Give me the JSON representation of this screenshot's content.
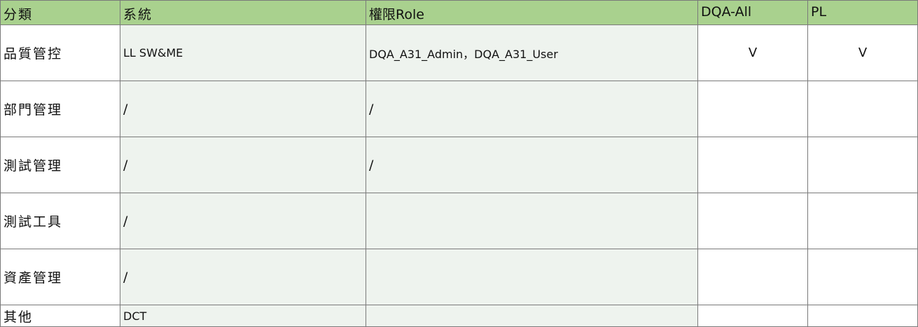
{
  "headers": {
    "category": "分類",
    "system": "系統",
    "role": "權限Role",
    "dqa_all": "DQA-All",
    "pl": "PL"
  },
  "rows": [
    {
      "category": "品質管控",
      "system": "LL SW&ME",
      "role": "DQA_A31_Admin，DQA_A31_User",
      "dqa_all": "V",
      "pl": "V"
    },
    {
      "category": "部門管理",
      "system": "/",
      "role": "/",
      "dqa_all": "",
      "pl": ""
    },
    {
      "category": "測試管理",
      "system": "/",
      "role": "/",
      "dqa_all": "",
      "pl": ""
    },
    {
      "category": "測試工具",
      "system": "/",
      "role": "",
      "dqa_all": "",
      "pl": ""
    },
    {
      "category": "資產管理",
      "system": "/",
      "role": "",
      "dqa_all": "",
      "pl": ""
    },
    {
      "category": "其他",
      "system": "DCT",
      "role": "",
      "dqa_all": "",
      "pl": ""
    }
  ],
  "colors": {
    "header_bg": "#a9d18e",
    "shaded_cell_bg": "#eef3ee",
    "border": "#7a7a7a"
  }
}
